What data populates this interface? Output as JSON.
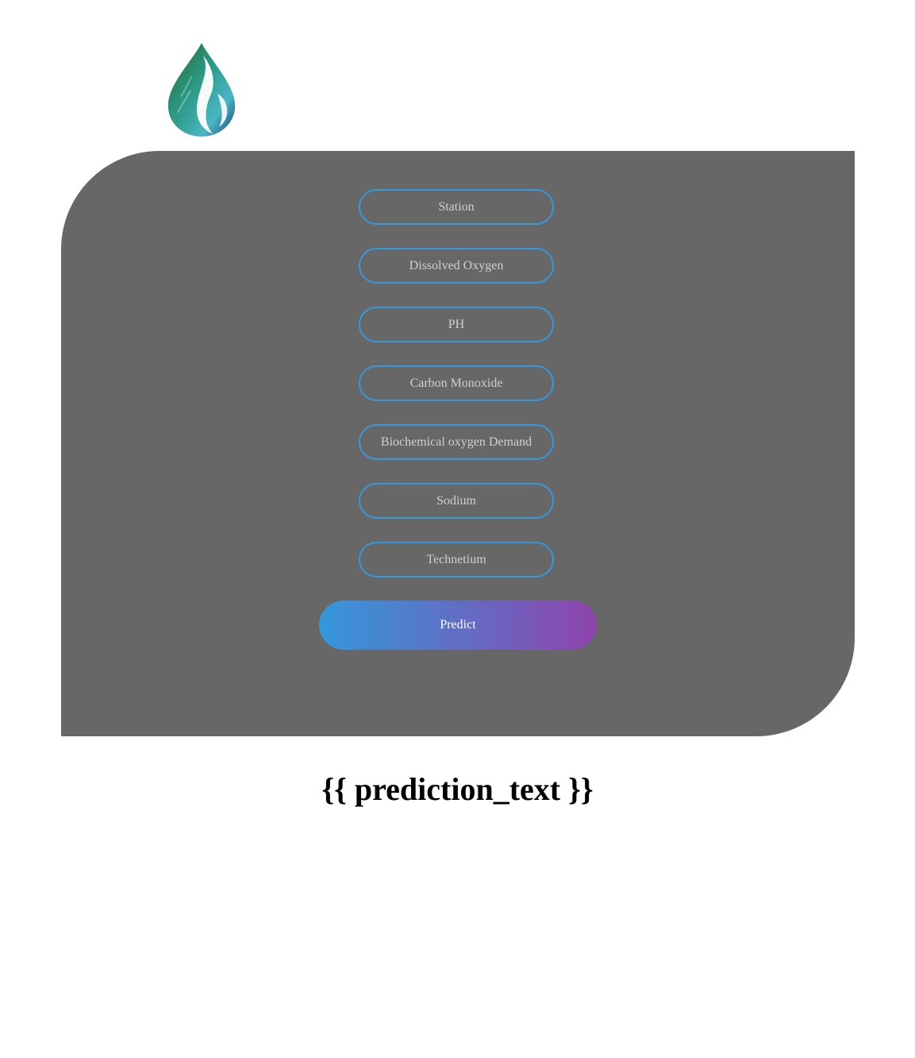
{
  "logo": {
    "icon": "water-drop-icon"
  },
  "form": {
    "fields": [
      {
        "placeholder": "Station"
      },
      {
        "placeholder": "Dissolved Oxygen"
      },
      {
        "placeholder": "PH"
      },
      {
        "placeholder": "Carbon Monoxide"
      },
      {
        "placeholder": "Biochemical oxygen Demand"
      },
      {
        "placeholder": "Sodium"
      },
      {
        "placeholder": "Technetium"
      }
    ],
    "submit_label": "Predict"
  },
  "result": {
    "text": "{{ prediction_text }}"
  },
  "colors": {
    "panel": "#676767",
    "field_border": "#3498db",
    "button_gradient_start": "#3498db",
    "button_gradient_end": "#8e44ad"
  }
}
